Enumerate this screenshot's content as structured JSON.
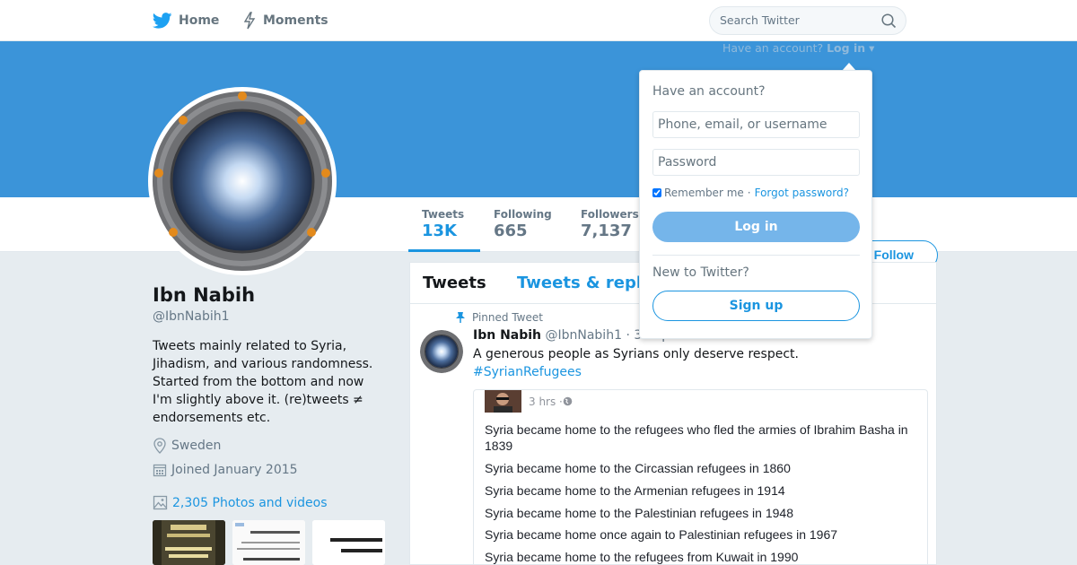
{
  "nav": {
    "home_label": "Home",
    "moments_label": "Moments",
    "search_placeholder": "Search Twitter"
  },
  "login_hint": {
    "prefix": "Have an account?",
    "link": "Log in"
  },
  "stats": {
    "tweets_label": "Tweets",
    "tweets_value": "13K",
    "following_label": "Following",
    "following_value": "665",
    "followers_label": "Followers",
    "followers_value": "7,137"
  },
  "follow_button": "Follow",
  "profile": {
    "name": "Ibn Nabih",
    "handle": "@IbnNabih1",
    "bio": "Tweets mainly related to Syria, Jihadism, and various randomness. Started from the bottom and now I'm slightly above it. (re)tweets ≠ endorsements etc.",
    "location": "Sweden",
    "joined": "Joined January 2015",
    "photos": "2,305 Photos and videos"
  },
  "timeline": {
    "tab_tweets": "Tweets",
    "tab_replies": "Tweets & replies",
    "pinned_label": "Pinned Tweet",
    "tweet": {
      "name": "Ibn Nabih",
      "handle": "@IbnNabih1",
      "time": "· 3 Sep 2015",
      "text": "A generous people as Syrians only deserve respect.",
      "hashtag": "#SyrianRefugees"
    },
    "embed": {
      "time": "3 hrs · ",
      "lines": [
        "Syria became home to the refugees who fled the armies of Ibrahim Basha in 1839",
        "Syria became home to the Circassian refugees in 1860",
        "Syria became home to the Armenian refugees in 1914",
        "Syria became home to the Palestinian refugees in 1948",
        "Syria became home once again to Palestinian refugees in 1967",
        "Syria became home to the refugees from Kuwait in 1990"
      ]
    }
  },
  "login_dropdown": {
    "title": "Have an account?",
    "phone_placeholder": "Phone, email, or username",
    "password_placeholder": "Password",
    "remember_label": "Remember me",
    "separator": "·",
    "forgot_label": "Forgot password?",
    "login_button": "Log in",
    "new_label": "New to Twitter?",
    "signup_button": "Sign up"
  },
  "colors": {
    "banner": "#3b94d9",
    "accent": "#1b95e0",
    "login_button": "#75b5ea"
  }
}
